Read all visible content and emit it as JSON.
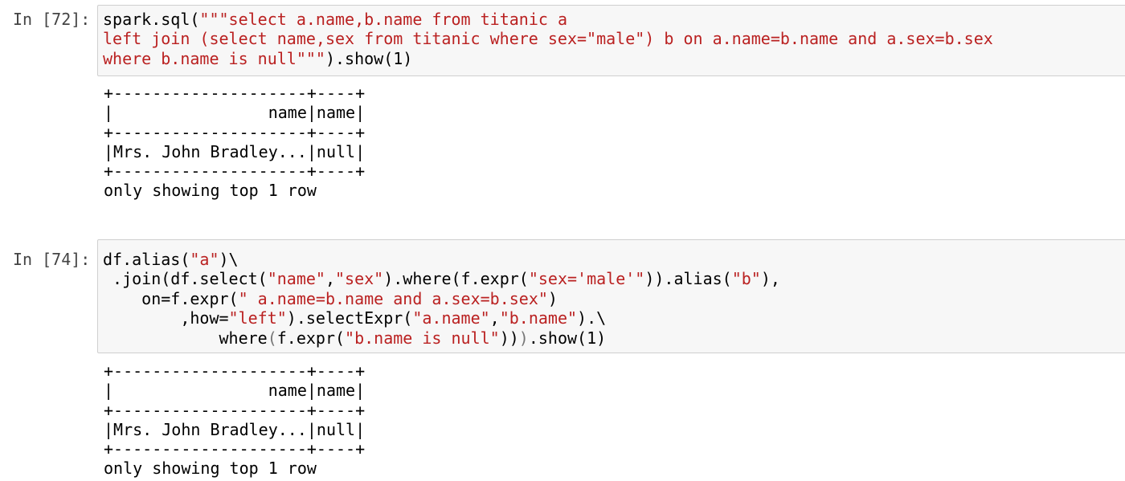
{
  "cells": [
    {
      "prompt": "In [72]:",
      "code_lines": [
        [
          {
            "t": "spark.sql(",
            "c": "plain"
          },
          {
            "t": "\"\"\"select a.name,b.name from titanic a",
            "c": "str"
          }
        ],
        [
          {
            "t": "left join (select name,sex from titanic where sex=\"male\") b on a.name=b.name and a.sex=b.sex",
            "c": "str"
          }
        ],
        [
          {
            "t": "where b.name is null\"\"\"",
            "c": "str"
          },
          {
            "t": ").show(1)",
            "c": "plain"
          }
        ]
      ],
      "output_lines": [
        "+--------------------+----+",
        "|                name|name|",
        "+--------------------+----+",
        "|Mrs. John Bradley...|null|",
        "+--------------------+----+",
        "only showing top 1 row"
      ]
    },
    {
      "prompt": "In [74]:",
      "code_lines": [
        [
          {
            "t": "df.alias(",
            "c": "plain"
          },
          {
            "t": "\"a\"",
            "c": "str"
          },
          {
            "t": ")\\",
            "c": "plain"
          }
        ],
        [
          {
            "t": " .join(df.select(",
            "c": "plain"
          },
          {
            "t": "\"name\"",
            "c": "str"
          },
          {
            "t": ",",
            "c": "plain"
          },
          {
            "t": "\"sex\"",
            "c": "str"
          },
          {
            "t": ").where(f.expr(",
            "c": "plain"
          },
          {
            "t": "\"sex='male'\"",
            "c": "str"
          },
          {
            "t": ")).alias(",
            "c": "plain"
          },
          {
            "t": "\"b\"",
            "c": "str"
          },
          {
            "t": "),",
            "c": "plain"
          }
        ],
        [
          {
            "t": "    on",
            "c": "plain"
          },
          {
            "t": "=",
            "c": "plain"
          },
          {
            "t": "f.expr(",
            "c": "plain"
          },
          {
            "t": "\" a.name=b.name and a.sex=b.sex\"",
            "c": "str"
          },
          {
            "t": ")",
            "c": "plain"
          }
        ],
        [
          {
            "t": "        ,how",
            "c": "plain"
          },
          {
            "t": "=",
            "c": "plain"
          },
          {
            "t": "\"left\"",
            "c": "str"
          },
          {
            "t": ").selectExpr(",
            "c": "plain"
          },
          {
            "t": "\"a.name\"",
            "c": "str"
          },
          {
            "t": ",",
            "c": "plain"
          },
          {
            "t": "\"b.name\"",
            "c": "str"
          },
          {
            "t": ").\\",
            "c": "plain"
          }
        ],
        [
          {
            "t": "            where",
            "c": "plain"
          },
          {
            "t": "(",
            "c": "paren-hl"
          },
          {
            "t": "f.expr(",
            "c": "plain"
          },
          {
            "t": "\"b.name is null\"",
            "c": "str"
          },
          {
            "t": "))",
            "c": "plain"
          },
          {
            "t": ")",
            "c": "paren-hl"
          },
          {
            "t": ".show(1)",
            "c": "plain"
          }
        ]
      ],
      "output_lines": [
        "+--------------------+----+",
        "|                name|name|",
        "+--------------------+----+",
        "|Mrs. John Bradley...|null|",
        "+--------------------+----+",
        "only showing top 1 row"
      ]
    }
  ]
}
